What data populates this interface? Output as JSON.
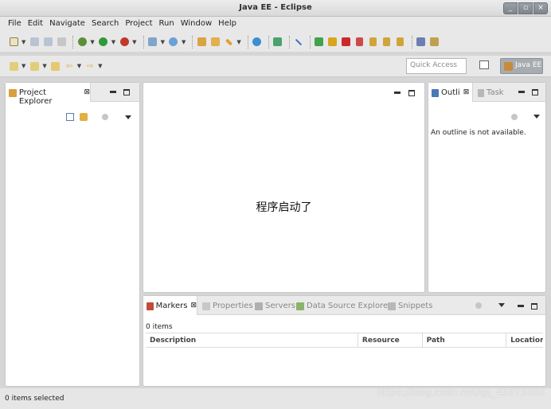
{
  "window": {
    "title": "Java EE - Eclipse",
    "buttons": [
      "_",
      "▫",
      "×"
    ]
  },
  "menu": [
    "File",
    "Edit",
    "Navigate",
    "Search",
    "Project",
    "Run",
    "Window",
    "Help"
  ],
  "toolbar": {
    "quick_access_placeholder": "Quick Access",
    "perspective_label": "Java EE"
  },
  "project_explorer": {
    "tab_label": "Project Explorer",
    "close": "⊠"
  },
  "editor": {
    "text": "程序启动了"
  },
  "outline": {
    "tab_label": "Outli",
    "close": "⊠",
    "task_tab_label": "Task",
    "message": "An outline is not available."
  },
  "bottom": {
    "tabs": {
      "markers": "Markers",
      "close": "⊠",
      "properties": "Properties",
      "servers": "Servers",
      "data_source": "Data Source Explorer",
      "snippets": "Snippets"
    },
    "items_count": "0 items",
    "columns": [
      "Description",
      "Resource",
      "Path",
      "Locatior"
    ]
  },
  "status": {
    "text": "0 items selected"
  },
  "watermark": "https://blog.csdn.net/qq_45973003",
  "colors": {
    "accent": "#c98a3a",
    "panel_bg": "#ffffff",
    "chrome_bg": "#e8e8e8"
  }
}
